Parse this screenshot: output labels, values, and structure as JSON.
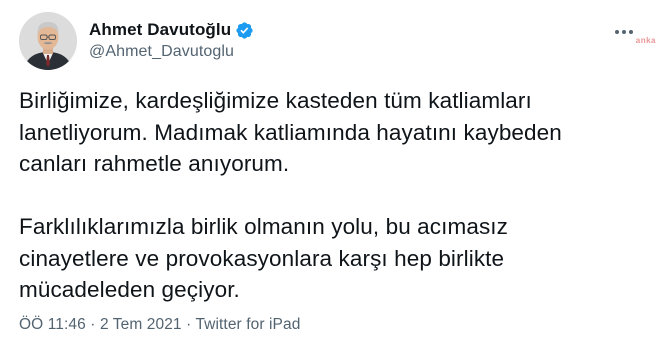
{
  "author": {
    "display_name": "Ahmet Davutoğlu",
    "handle": "@Ahmet_Davutoglu",
    "verified": true,
    "verified_color": "#1d9bf0"
  },
  "watermark": "anka",
  "tweet": {
    "lines_para1": [
      "Birliğimize, kardeşliğimize kasteden tüm katliamları",
      "lanetliyorum. Madımak katliamında hayatını kaybeden",
      "canları rahmetle anıyorum."
    ],
    "lines_para2": [
      "Farklılıklarımızla birlik olmanın yolu, bu acımasız",
      "cinayetlere ve provokasyonlara karşı hep birlikte",
      "mücadeleden geçiyor."
    ]
  },
  "meta": {
    "time": "ÖÖ 11:46",
    "separator": " · ",
    "date": "2 Tem 2021",
    "source": "Twitter for iPad"
  },
  "icons": {
    "more": "more-options-icon",
    "verified": "verified-badge-icon"
  }
}
